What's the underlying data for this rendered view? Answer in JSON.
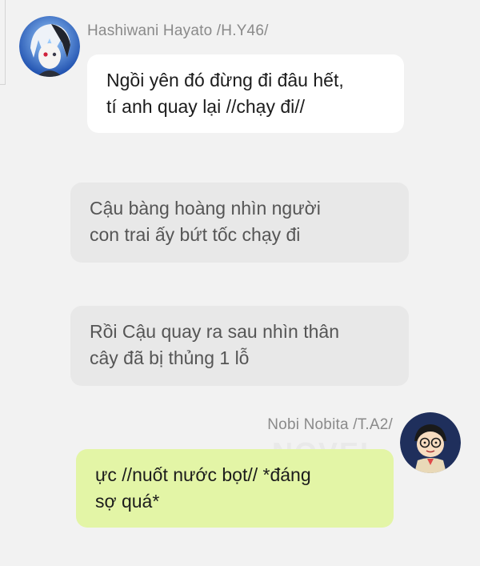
{
  "messages": [
    {
      "sender": "Hashiwani Hayato /H.Y46/",
      "lines": [
        "Ngồi yên đó đừng đi đâu hết,",
        "tí anh quay lại //chạy đi//"
      ]
    },
    {
      "type": "narration",
      "lines": [
        "Cậu bàng hoàng nhìn người",
        "con trai ấy bứt tốc chạy đi"
      ]
    },
    {
      "type": "narration",
      "lines": [
        "Rồi Cậu quay ra sau nhìn thân",
        "cây đã bị thủng 1 lỗ"
      ]
    },
    {
      "sender": "Nobi Nobita /T.A2/",
      "lines": [
        "ực //nuốt nước bọt// *đáng",
        "sợ quá*"
      ]
    }
  ],
  "watermark": "NOVEL",
  "colors": {
    "background": "#f2f2f2",
    "incoming_bubble": "#ffffff",
    "narration_bubble": "#e8e8e8",
    "outgoing_bubble": "#e3f5a6",
    "name_text": "#8a8a8a"
  },
  "icons": {
    "avatar_1": "anime-boy-silver-hair-avatar",
    "avatar_2": "nobita-cartoon-avatar"
  }
}
